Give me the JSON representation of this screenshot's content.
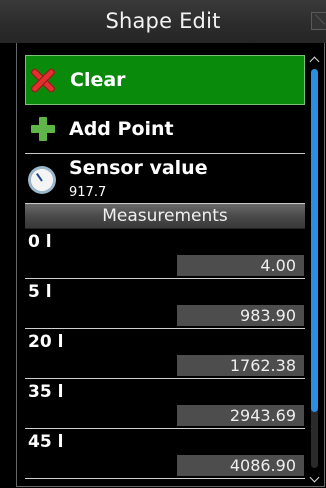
{
  "window": {
    "title": "Shape Edit"
  },
  "actions": {
    "clear_label": "Clear",
    "add_point_label": "Add Point"
  },
  "sensor": {
    "label": "Sensor value",
    "value": "917.7"
  },
  "measurements": {
    "header": "Measurements",
    "rows": [
      {
        "label": "0 l",
        "value": "4.00"
      },
      {
        "label": "5 l",
        "value": "983.90"
      },
      {
        "label": "20 l",
        "value": "1762.38"
      },
      {
        "label": "35 l",
        "value": "2943.69"
      },
      {
        "label": "45 l",
        "value": "4086.90"
      }
    ]
  },
  "scrollbar": {
    "thumb_fraction": 0.86,
    "thumb_start": 0.0
  },
  "colors": {
    "clear_background": "#0a8a0a",
    "scroll_thumb": "#2b8ee0",
    "value_box": "#4d4d4d"
  },
  "icons": {
    "clear": "red-x-icon",
    "add": "green-plus-icon",
    "sensor": "gauge-icon"
  }
}
